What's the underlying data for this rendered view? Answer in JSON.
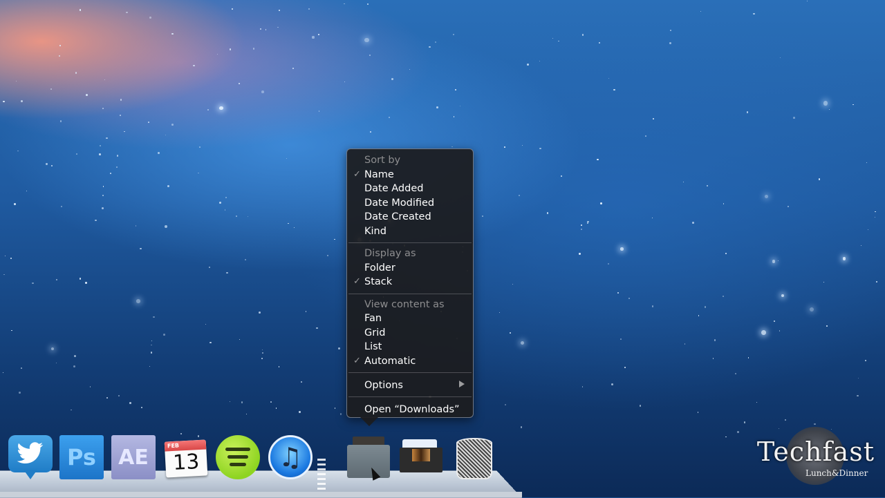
{
  "context_menu": {
    "sections": [
      {
        "header": "Sort by",
        "items": [
          {
            "label": "Name",
            "checked": true
          },
          {
            "label": "Date Added",
            "checked": false
          },
          {
            "label": "Date Modified",
            "checked": false
          },
          {
            "label": "Date Created",
            "checked": false
          },
          {
            "label": "Kind",
            "checked": false
          }
        ]
      },
      {
        "header": "Display as",
        "items": [
          {
            "label": "Folder",
            "checked": false
          },
          {
            "label": "Stack",
            "checked": true
          }
        ]
      },
      {
        "header": "View content as",
        "items": [
          {
            "label": "Fan",
            "checked": false
          },
          {
            "label": "Grid",
            "checked": false
          },
          {
            "label": "List",
            "checked": false
          },
          {
            "label": "Automatic",
            "checked": true
          }
        ]
      }
    ],
    "options_label": "Options",
    "open_label": "Open “Downloads”",
    "check_glyph": "✓"
  },
  "dock": {
    "items": [
      {
        "name": "Twitter",
        "icon": "twitter-bird-icon"
      },
      {
        "name": "Photoshop",
        "icon": "photoshop-icon",
        "text": "Ps"
      },
      {
        "name": "After Effects",
        "icon": "after-effects-icon",
        "text": "AE"
      },
      {
        "name": "iCal",
        "icon": "calendar-icon",
        "month": "FEB",
        "day": "13"
      },
      {
        "name": "Spotify",
        "icon": "spotify-icon"
      },
      {
        "name": "iTunes",
        "icon": "itunes-icon",
        "glyph": "♫"
      },
      {
        "name": "Downloads",
        "icon": "downloads-stack-icon"
      },
      {
        "name": "Documents",
        "icon": "documents-stack-icon"
      },
      {
        "name": "Trash",
        "icon": "trash-icon"
      }
    ]
  },
  "watermark": {
    "brand": "Techfast",
    "tagline": "Lunch&Dinner"
  },
  "colors": {
    "menu_bg": "#1c1c1e",
    "menu_header": "#8d8d8f",
    "menu_text": "#ffffff",
    "wallpaper_blue": "#1f5aa0"
  }
}
